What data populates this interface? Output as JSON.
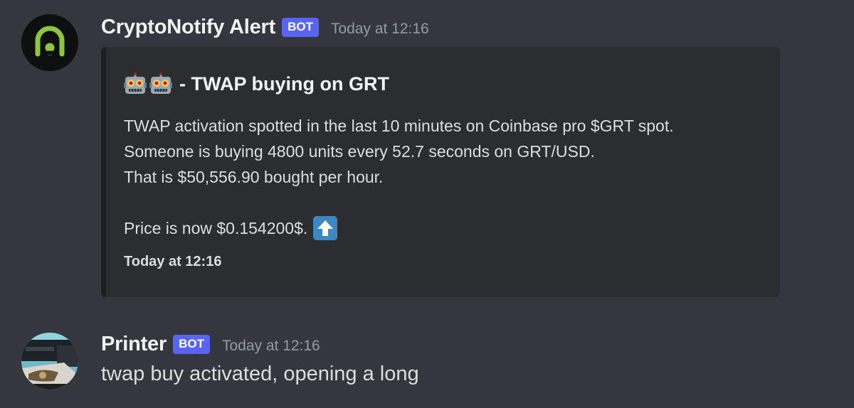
{
  "messages": [
    {
      "author": "CryptoNotify Alert",
      "badge": "BOT",
      "timestamp": "Today at 12:16",
      "avatar_icon": "crypto-notify-logo",
      "embed": {
        "title_icons": [
          "robot-emoji",
          "robot-emoji"
        ],
        "title": "- TWAP buying on GRT",
        "description_lines": [
          "TWAP activation spotted in the last 10 minutes on Coinbase pro $GRT spot.",
          "Someone is buying 4800 units every 52.7 seconds on GRT/USD.",
          "That is $50,556.90 bought per hour."
        ],
        "price_text": "Price is now $0.154200$.",
        "price_icon": "up-arrow-emoji",
        "footer": "Today at 12:16"
      }
    },
    {
      "author": "Printer",
      "badge": "BOT",
      "timestamp": "Today at 12:16",
      "avatar_icon": "printer-photo-avatar",
      "text": "twap buy activated, opening a long"
    }
  ],
  "colors": {
    "background": "#36373e",
    "embed_background": "#2b2d31",
    "bot_badge": "#5865f2",
    "timestamp": "#949ba4",
    "logo_green": "#8dc63f"
  }
}
